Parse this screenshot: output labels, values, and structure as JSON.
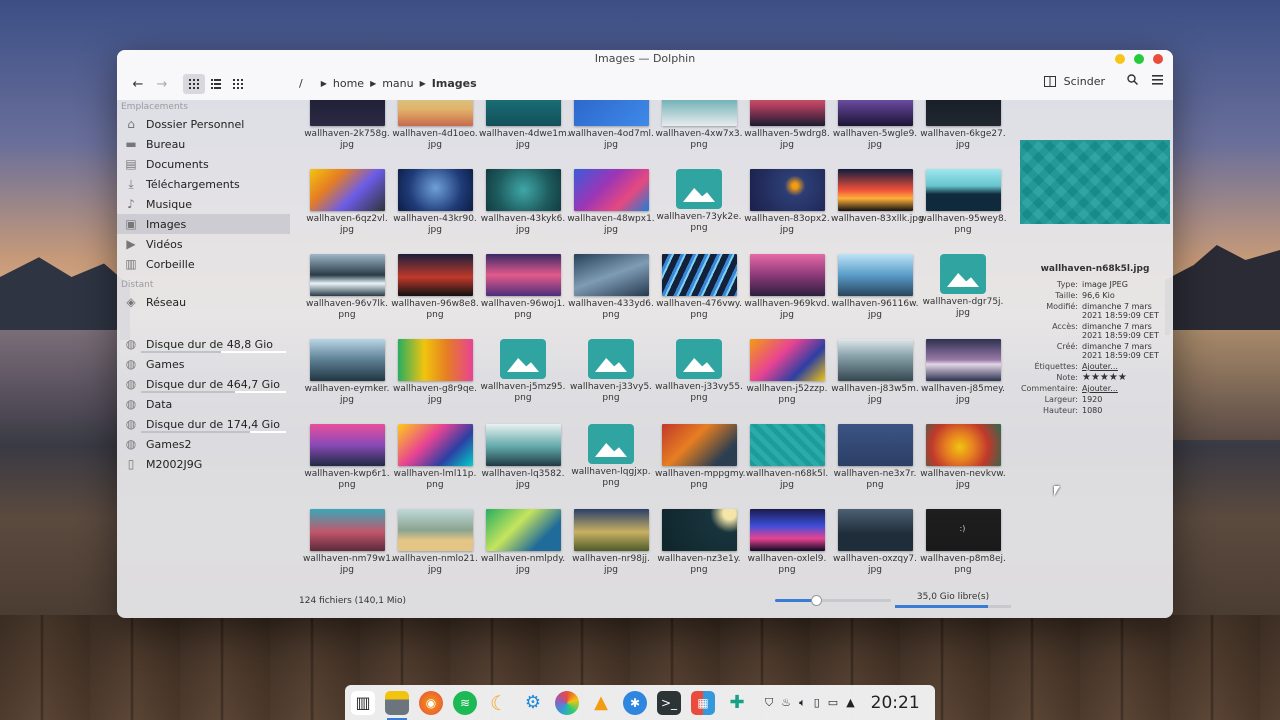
{
  "window": {
    "title": "Images — Dolphin",
    "colors": {
      "close": "#e74c3c",
      "maximize": "#27c93f",
      "minimize": "#f5c518"
    }
  },
  "toolbar": {
    "breadcrumb": [
      "/",
      "home",
      "manu",
      "Images"
    ],
    "split_label": "Scinder"
  },
  "sidebar": {
    "places_header": "Emplacements",
    "places": [
      {
        "label": "Dossier Personnel",
        "icon": "home-icon"
      },
      {
        "label": "Bureau",
        "icon": "desktop-folder-icon"
      },
      {
        "label": "Documents",
        "icon": "documents-folder-icon"
      },
      {
        "label": "Téléchargements",
        "icon": "download-folder-icon"
      },
      {
        "label": "Musique",
        "icon": "music-folder-icon"
      },
      {
        "label": "Images",
        "icon": "pictures-folder-icon",
        "selected": true
      },
      {
        "label": "Vidéos",
        "icon": "videos-folder-icon"
      },
      {
        "label": "Corbeille",
        "icon": "trash-icon"
      }
    ],
    "remote_header": "Distant",
    "network": "Réseau",
    "devices": [
      {
        "label": "Disque dur de 48,8 Gio",
        "usage": 0.55
      },
      {
        "label": "Games",
        "usage": null
      },
      {
        "label": "Disque dur de 464,7 Gio",
        "usage": 0.65
      },
      {
        "label": "Data",
        "usage": null
      },
      {
        "label": "Disque dur de 174,4 Gio",
        "usage": 0.75
      },
      {
        "label": "Games2",
        "usage": null
      },
      {
        "label": "M2002J9G",
        "usage": null
      }
    ]
  },
  "files": [
    {
      "name1": "wallhaven-2k758g.",
      "name2": "jpg",
      "color": "#ffb347",
      "bg": "linear-gradient(180deg,#1a1a2e,#2a2a44)"
    },
    {
      "name1": "wallhaven-4d1oeo.",
      "name2": "jpg",
      "bg": "linear-gradient(180deg,#c9d6a3,#e2b36a 60%,#c86a4b)"
    },
    {
      "name1": "wallhaven-4dwe1m.",
      "name2": "jpg",
      "bg": "linear-gradient(180deg,#1f7f86,#125059)"
    },
    {
      "name1": "wallhaven-4od7ml.",
      "name2": "jpg",
      "bg": "linear-gradient(135deg,#2a63c9,#3f8ae8)"
    },
    {
      "name1": "wallhaven-4xw7x3.",
      "name2": "png",
      "bg": "linear-gradient(180deg,#2b8f93,#e8ecef)"
    },
    {
      "name1": "wallhaven-5wdrg8.",
      "name2": "jpg",
      "bg": "linear-gradient(180deg,#f08a5d,#b33f62 50%,#1b1b2f)"
    },
    {
      "name1": "wallhaven-5wgle9.",
      "name2": "jpg",
      "bg": "linear-gradient(180deg,#9b7bd4,#5b3f8c 50%,#1c1535)"
    },
    {
      "name1": "wallhaven-6kge27.",
      "name2": "jpg",
      "bg": "linear-gradient(180deg,#151a22,#202730)"
    },
    {
      "name1": "wallhaven-6qz2vl.",
      "name2": "jpg",
      "bg": "linear-gradient(135deg,#f1c40f,#e67e22 30%,#6c5ce7 60%,#2d3436)"
    },
    {
      "name1": "wallhaven-43kr90.",
      "name2": "jpg",
      "bg": "radial-gradient(circle at 50% 45%,#6fa0d9,#1f3b78 60%,#0d1d44)"
    },
    {
      "name1": "wallhaven-43kyk6.",
      "name2": "jpg",
      "bg": "radial-gradient(circle at 50% 50%,#3fa7a7,#1e5c5f 60%,#123c40)"
    },
    {
      "name1": "wallhaven-48wpx1.",
      "name2": "jpg",
      "bg": "linear-gradient(135deg,#3b5bdb,#9c36b5 40%,#e64980 70%,#1c7ed6)"
    },
    {
      "name1": "wallhaven-73yk2e.",
      "name2": "png",
      "placeholder": true
    },
    {
      "name1": "wallhaven-83opx2.",
      "name2": "jpg",
      "bg": "radial-gradient(circle at 60% 40%,#f39c12 5%,#2c3e75 20%,#1b1f4a)"
    },
    {
      "name1": "wallhaven-83xllk.jpg",
      "name2": "",
      "bg": "linear-gradient(180deg,#0f1c3f,#f0503a 50%,#ffb03a 70%,#111)"
    },
    {
      "name1": "wallhaven-95wey8.",
      "name2": "png",
      "bg": "linear-gradient(180deg,#9fe6ee,#66c5cf 40%,#0e2a3b 60%)"
    },
    {
      "name1": "wallhaven-96v7lk.",
      "name2": "png",
      "bg": "linear-gradient(180deg,#9fb7c9,#2a3b47 50%,#e7f3f8 70%,#2a3b47)"
    },
    {
      "name1": "wallhaven-96w8e8.",
      "name2": "png",
      "bg": "linear-gradient(180deg,#1a1f3a,#c0392b 55%,#111)"
    },
    {
      "name1": "wallhaven-96woj1.",
      "name2": "png",
      "bg": "linear-gradient(180deg,#3a2a66,#e35a8b 50%,#4c2e7a)"
    },
    {
      "name1": "wallhaven-433yd6.",
      "name2": "png",
      "bg": "linear-gradient(160deg,#26405a,#7f9cb5 50%,#263a50)"
    },
    {
      "name1": "wallhaven-476vwy.",
      "name2": "png",
      "bg": "repeating-linear-gradient(115deg,#13213b 0 6px,#3a86d9 6px 9px,#7fd3f0 9px 11px)"
    },
    {
      "name1": "wallhaven-969kvd.",
      "name2": "jpg",
      "bg": "linear-gradient(180deg,#e56aa6,#8e3a7a 50%,#2c1f3d)"
    },
    {
      "name1": "wallhaven-96116w.",
      "name2": "jpg",
      "bg": "linear-gradient(180deg,#bde3f5,#5a9cc9 50%,#27455c)"
    },
    {
      "name1": "wallhaven-dgr75j.",
      "name2": "jpg",
      "placeholder": true
    },
    {
      "name1": "wallhaven-eymker.",
      "name2": "jpg",
      "bg": "linear-gradient(180deg,#b8d6e6,#5c7f93 50%,#223642)"
    },
    {
      "name1": "wallhaven-g8r9qe.",
      "name2": "jpg",
      "bg": "linear-gradient(90deg,#27ae60,#f1c40f 35%,#e67e22 65%,#e84393)"
    },
    {
      "name1": "wallhaven-j5mz95.",
      "name2": "png",
      "placeholder": true
    },
    {
      "name1": "wallhaven-j33vy5.",
      "name2": "png",
      "placeholder": true
    },
    {
      "name1": "wallhaven-j33vy55.",
      "name2": "png",
      "placeholder": true
    },
    {
      "name1": "wallhaven-j52zzp.",
      "name2": "png",
      "bg": "linear-gradient(135deg,#f39c12,#e84393 40%,#2d3fa3 70%,#f1c40f)"
    },
    {
      "name1": "wallhaven-j83w5m.",
      "name2": "jpg",
      "bg": "linear-gradient(180deg,#dfe7ea,#8aa3ad 40%,#35474f)"
    },
    {
      "name1": "wallhaven-j85mey.",
      "name2": "jpg",
      "bg": "linear-gradient(180deg,#2d3250,#9a7aa8 50%,#e2d6e7 60%,#2d3250)"
    },
    {
      "name1": "wallhaven-kwp6r1.",
      "name2": "png",
      "bg": "linear-gradient(180deg,#e94e9c,#8a4ab7 50%,#1f2a44)"
    },
    {
      "name1": "wallhaven-lml11p.",
      "name2": "png",
      "bg": "linear-gradient(135deg,#fdcb1a,#e84393 40%,#2d3fa3 70%,#00cec9)"
    },
    {
      "name1": "wallhaven-lq3582.",
      "name2": "jpg",
      "bg": "linear-gradient(180deg,#e9f1f2,#5fa7a8 55%,#203a44)"
    },
    {
      "name1": "wallhaven-lqgjxp.",
      "name2": "png",
      "placeholder": true
    },
    {
      "name1": "wallhaven-mppgmy.",
      "name2": "png",
      "bg": "linear-gradient(135deg,#c0392b,#e67e22 40%,#2c3e50 80%)"
    },
    {
      "name1": "wallhaven-n68k5l.",
      "name2": "jpg",
      "bg": "repeating-linear-gradient(45deg,#1c9d9c 0 5px,#2aacab 5px 10px)",
      "selected": true
    },
    {
      "name1": "wallhaven-ne3x7r.",
      "name2": "png",
      "bg": "linear-gradient(180deg,#3b5484,#2b3f66)"
    },
    {
      "name1": "wallhaven-nevkvw.",
      "name2": "jpg",
      "bg": "radial-gradient(circle at 45% 55%,#f1c40f,#e67e22 30%,#c0392b 60%,#2d6a4f)"
    },
    {
      "name1": "wallhaven-nm79w1.",
      "name2": "jpg",
      "bg": "linear-gradient(180deg,#3aa7b8,#c2566b 55%,#5a2a3a)"
    },
    {
      "name1": "wallhaven-nmlo21.",
      "name2": "jpg",
      "bg": "linear-gradient(180deg,#bfd9da,#8aa490 50%,#e4c586 75%)"
    },
    {
      "name1": "wallhaven-nmlpdy.",
      "name2": "jpg",
      "bg": "linear-gradient(135deg,#27ae60,#c5e45e 40%,#1f6b9a 75%)"
    },
    {
      "name1": "wallhaven-nr98jj.",
      "name2": "jpg",
      "bg": "linear-gradient(180deg,#2a3f6a,#c9b162 55%,#4d5b2a)"
    },
    {
      "name1": "wallhaven-nz3e1y.",
      "name2": "png",
      "bg": "radial-gradient(circle at 90% 10%,#f5e6a7 8%,#18343d 25%,#0f242b)"
    },
    {
      "name1": "wallhaven-oxlel9.",
      "name2": "png",
      "bg": "linear-gradient(180deg,#1b1b4d,#3d4ed8 40%,#e84393 70%,#0a0a22)"
    },
    {
      "name1": "wallhaven-oxzqy7.",
      "name2": "jpg",
      "bg": "linear-gradient(180deg,#4c5f73,#1f2d3a 60%)"
    },
    {
      "name1": "wallhaven-p8m8ej.",
      "name2": "png",
      "bg": "linear-gradient(180deg,#1e1e1e,#1a1a1a)",
      "text": ":)"
    }
  ],
  "info_panel": {
    "filename": "wallhaven-n68k5l.jpg",
    "rows": [
      {
        "key": "Type:",
        "value": "image JPEG"
      },
      {
        "key": "Taille:",
        "value": "96,6 Kio"
      },
      {
        "key": "Modifié:",
        "value": "dimanche 7 mars 2021 18:59:09 CET"
      },
      {
        "key": "Accès:",
        "value": "dimanche 7 mars 2021 18:59:09 CET"
      },
      {
        "key": "Créé:",
        "value": "dimanche 7 mars 2021 18:59:09 CET"
      }
    ],
    "tags_key": "Étiquettes:",
    "tags_link": "Ajouter...",
    "rating_key": "Note:",
    "rating_stars": "★★★★★",
    "comment_key": "Commentaire:",
    "comment_link": "Ajouter...",
    "width_key": "Largeur:",
    "width_value": "1920",
    "height_key": "Hauteur:",
    "height_value": "1080"
  },
  "status": {
    "count": "124 fichiers (140,1 Mio)",
    "zoom_level": 0.35,
    "free_space": "35,0 Gio libre(s)",
    "free_usage": 0.8
  },
  "taskbar": {
    "clock": "20:21"
  }
}
